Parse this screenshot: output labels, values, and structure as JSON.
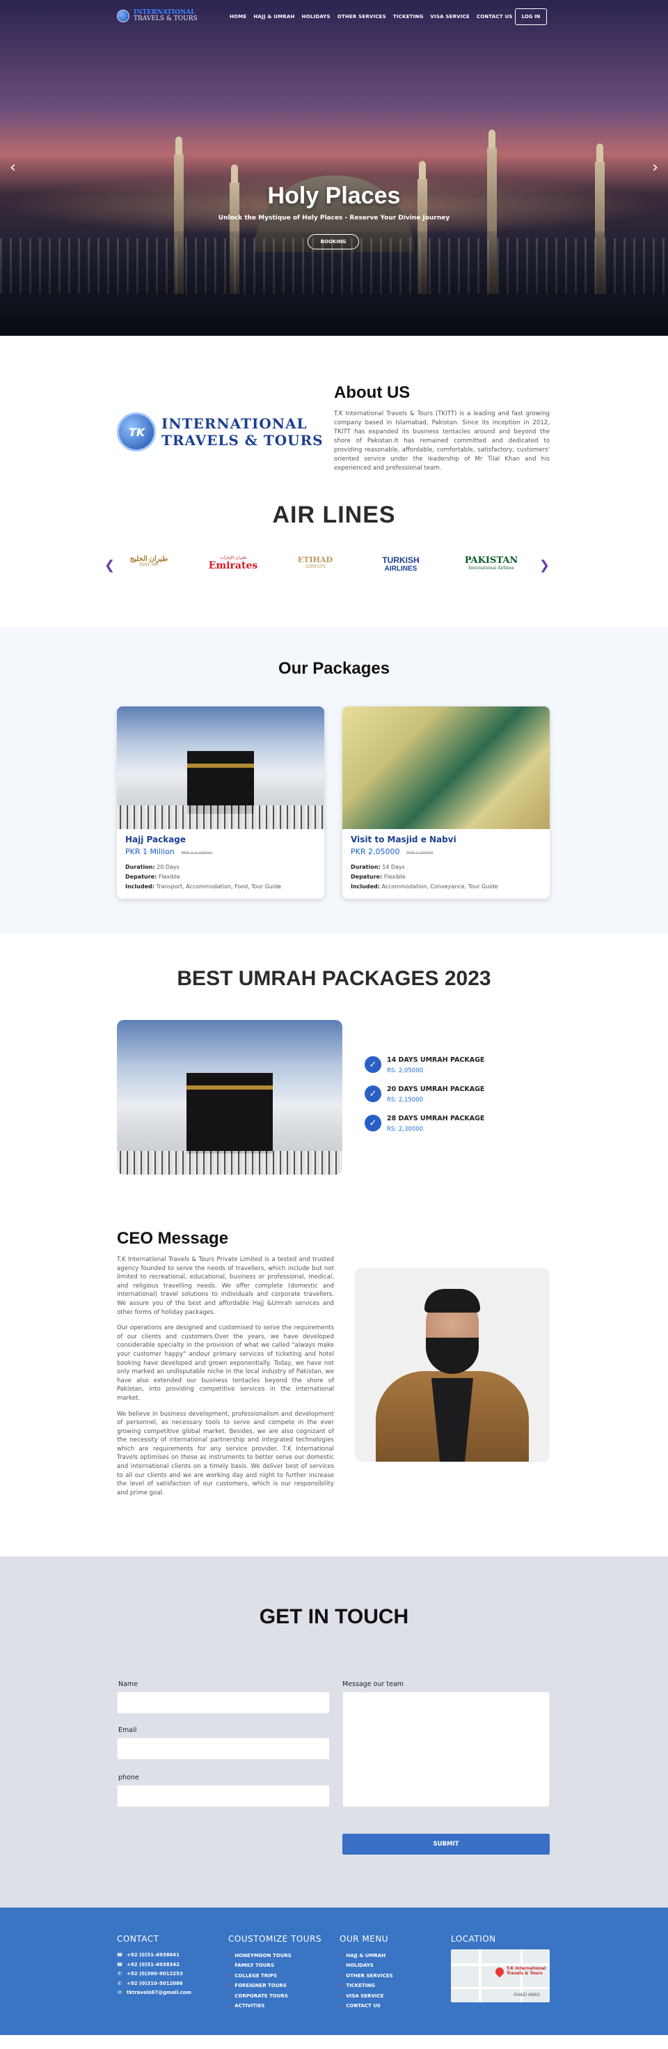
{
  "nav": {
    "logo_line1": "INTERNATIONAL",
    "logo_line2": "TRAVELS & TOURS",
    "menu": [
      "HOME",
      "HAJJ & UMRAH",
      "HOLIDAYS",
      "OTHER SERVICES",
      "TICKETING",
      "VISA SERVICE",
      "CONTACT US"
    ],
    "login": "LOG IN"
  },
  "hero": {
    "title": "Holy Places",
    "subtitle": "Unlock the Mystique of Holy Places - Reserve Your Divine Journey",
    "button": "BOOKING",
    "prev": "‹",
    "next": "›"
  },
  "about": {
    "logo_line1": "INTERNATIONAL",
    "logo_line2": "TRAVELS & TOURS",
    "title": "About US",
    "text": "T.K International Travels & Tours (TKITT) is a leading and fast growing company based in Islamabad, Pakistan. Since its inception in 2012, TKITT has expanded its business tentacles around and beyond the shore of Pakistan.It has remained committed and dedicated to providing reasonable, affordable, comfortable, satisfactory, customers' oriented service under the leadership of Mr Tilal Khan and his experienced and professional team."
  },
  "airlines": {
    "title": "AIR LINES",
    "logos": [
      {
        "name": "طيران الخليج",
        "sub": "GULF AIR",
        "color": "#a57c2c"
      },
      {
        "name": "Emirates",
        "sub": "طيران الإمارات",
        "color": "#d71920"
      },
      {
        "name": "ETIHAD",
        "sub": "AIRWAYS",
        "color": "#bd9a5f"
      },
      {
        "name": "TURKISH",
        "sub": "AIRLINES",
        "color": "#1b3f91"
      },
      {
        "name": "PAKISTAN",
        "sub": "International Airlines",
        "color": "#0b5a2b"
      }
    ]
  },
  "packages": {
    "title": "Our Packages",
    "cards": [
      {
        "name": "Hajj Package",
        "price": "PKR  1 Million",
        "old": "PKR 1.2 million",
        "duration_label": "Duration:",
        "duration": "20 Days",
        "departure_label": "Depature:",
        "departure": "Flexible",
        "included_label": "Included:",
        "included": "Transport, Accommodation, Food, Tour Guide"
      },
      {
        "name": "Visit to Masjid e Nabvi",
        "price": "PKR 2,05000",
        "old": "PKR 2,30000",
        "duration_label": "Duration:",
        "duration": "14 Days",
        "departure_label": "Depature:",
        "departure": "Flexible",
        "included_label": "Included:",
        "included": "Accommodation, Conveyance, Tour Guide"
      }
    ]
  },
  "umrah": {
    "title": "BEST UMRAH PACKAGES 2023",
    "items": [
      {
        "title": "14 DAYS UMRAH PACKAGE",
        "price": "RS: 2,05000"
      },
      {
        "title": "20 DAYS UMRAH PACKAGE",
        "price": "RS: 2,15000"
      },
      {
        "title": "28 DAYS UMRAH PACKAGE",
        "price": "RS: 2,30000"
      }
    ]
  },
  "ceo": {
    "title": "CEO Message",
    "paragraphs": [
      "T.K International Travels & Tours Private Limited is a tested and trusted agency founded to serve the needs of travellers, which include but not limited to recreational, educational, business or professional, medical, and religious travelling needs. We offer complete (domestic and international) travel solutions to individuals and corporate travellers. We assure you of the best and affordable Hajj &Umrah services and other forms of holiday packages.",
      "Our operations are designed and customised to serve the requirements of our clients and customers.Over the years, we have developed considerable specialty in the provision of what we called \"always make your customer happy\" andour primary services of ticketing and hotel booking have developed and grown exponentially. Today, we have not only marked an undisputable niche in the local industry of Pakistan, we have also extended our business tentacles beyond the shore of Pakistan, into providing competitive services in the international market.",
      "We believe in business development, professionalism and development of personnel, as necessary tools to serve and compete in the ever growing competitive global market. Besides, we are also cognizant of the necessity of international partnership and integrated technologies which are requirements for any service provider. T.K International Travels optimises on these as instruments to better serve our domestic and international clients on a timely basis. We deliver best of services to all our clients and we are working day and night to further increase the level of satisfaction of our customers, which is our responsibility and prime goal."
    ]
  },
  "contact": {
    "title": "GET IN TOUCH",
    "name_label": "Name",
    "email_label": "Email",
    "phone_label": "phone",
    "message_label": "Message our team",
    "submit": "SUBMIT"
  },
  "footer": {
    "contact_title": "CONTACT",
    "contact": [
      {
        "icon": "phone-icon",
        "text": "+92 (0)51-4938041"
      },
      {
        "icon": "phone-icon",
        "text": "+92 (0)51-4938342"
      },
      {
        "icon": "phone-icon",
        "text": "+92 (0)300-9012253"
      },
      {
        "icon": "phone-icon",
        "text": "+92 (0)310-5012086"
      },
      {
        "icon": "mail-icon",
        "text": "tktravels67@gmail.com"
      }
    ],
    "tours_title": "COUSTOMIZE TOURS",
    "tours": [
      "HONEYMOON TOURS",
      "FAMILY TOURS",
      "COLLEGE TRIPS",
      "FOREIGNER TOURS",
      "CORPORATE TOURS",
      "ACTIVITIES"
    ],
    "menu_title": "OUR MENU",
    "menu": [
      "HAJJ & UMRAH",
      "HOLIDAYS",
      "OTHER SERVICES",
      "TICKETING",
      "VISA SERVICE",
      "CONTACT US"
    ],
    "location_title": "LOCATION",
    "map_label": "T.K International Travels & Tours",
    "map_area": "GHAZI ABAD"
  }
}
